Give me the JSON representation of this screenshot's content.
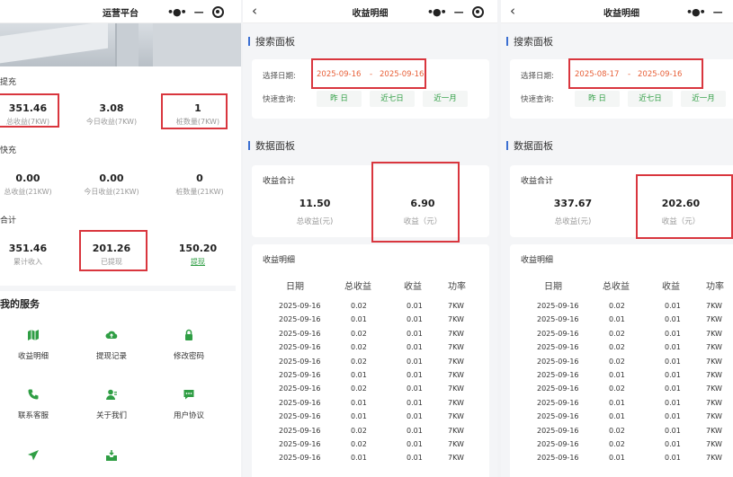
{
  "panel1": {
    "title": "运营平台",
    "section_a": "提充",
    "stats_a": [
      {
        "value": "351.46",
        "label": "总收益(7KW)"
      },
      {
        "value": "3.08",
        "label": "今日收益(7KW)"
      },
      {
        "value": "1",
        "label": "桩数量(7KW)"
      }
    ],
    "section_b": "快充",
    "stats_b": [
      {
        "value": "0.00",
        "label": "总收益(21KW)"
      },
      {
        "value": "0.00",
        "label": "今日收益(21KW)"
      },
      {
        "value": "0",
        "label": "桩数量(21KW)"
      }
    ],
    "section_c": "合计",
    "stats_c": [
      {
        "value": "351.46",
        "label": "累计收入"
      },
      {
        "value": "201.26",
        "label": "已提现"
      },
      {
        "value": "150.20",
        "label": "提现"
      }
    ],
    "services_title": "我的服务",
    "services": [
      {
        "label": "收益明细",
        "icon": "map-icon"
      },
      {
        "label": "提现记录",
        "icon": "cloud-upload-icon"
      },
      {
        "label": "修改密码",
        "icon": "lock-icon"
      },
      {
        "label": "联系客服",
        "icon": "phone-icon"
      },
      {
        "label": "关于我们",
        "icon": "user-info-icon"
      },
      {
        "label": "用户协议",
        "icon": "chat-icon"
      },
      {
        "label": "",
        "icon": "send-icon"
      },
      {
        "label": "",
        "icon": "inbox-download-icon"
      }
    ],
    "accent_color": "#2f9e44"
  },
  "detail": {
    "title": "收益明细",
    "search_panel_label": "搜索面板",
    "date_label": "选择日期:",
    "date_separator": "-",
    "quick_label": "快速查询:",
    "quick_buttons": [
      "昨 日",
      "近七日",
      "近一月"
    ],
    "data_panel_label": "数据面板",
    "sum_title": "收益合计",
    "total_label": "总收益(元)",
    "income_label": "收益（元）",
    "detail_title": "收益明细",
    "table_headers": [
      "日期",
      "总收益",
      "收益",
      "功率"
    ]
  },
  "panel2": {
    "date_start": "2025-09-16",
    "date_end": "2025-09-16",
    "total": "11.50",
    "income": "6.90",
    "rows": [
      [
        "2025-09-16",
        "0.02",
        "0.01",
        "7KW"
      ],
      [
        "2025-09-16",
        "0.01",
        "0.01",
        "7KW"
      ],
      [
        "2025-09-16",
        "0.02",
        "0.01",
        "7KW"
      ],
      [
        "2025-09-16",
        "0.02",
        "0.01",
        "7KW"
      ],
      [
        "2025-09-16",
        "0.02",
        "0.01",
        "7KW"
      ],
      [
        "2025-09-16",
        "0.01",
        "0.01",
        "7KW"
      ],
      [
        "2025-09-16",
        "0.02",
        "0.01",
        "7KW"
      ],
      [
        "2025-09-16",
        "0.01",
        "0.01",
        "7KW"
      ],
      [
        "2025-09-16",
        "0.01",
        "0.01",
        "7KW"
      ],
      [
        "2025-09-16",
        "0.02",
        "0.01",
        "7KW"
      ],
      [
        "2025-09-16",
        "0.02",
        "0.01",
        "7KW"
      ],
      [
        "2025-09-16",
        "0.01",
        "0.01",
        "7KW"
      ]
    ]
  },
  "panel3": {
    "date_start": "2025-08-17",
    "date_end": "2025-09-16",
    "total": "337.67",
    "income": "202.60",
    "rows": [
      [
        "2025-09-16",
        "0.02",
        "0.01",
        "7KW"
      ],
      [
        "2025-09-16",
        "0.01",
        "0.01",
        "7KW"
      ],
      [
        "2025-09-16",
        "0.02",
        "0.01",
        "7KW"
      ],
      [
        "2025-09-16",
        "0.02",
        "0.01",
        "7KW"
      ],
      [
        "2025-09-16",
        "0.02",
        "0.01",
        "7KW"
      ],
      [
        "2025-09-16",
        "0.01",
        "0.01",
        "7KW"
      ],
      [
        "2025-09-16",
        "0.02",
        "0.01",
        "7KW"
      ],
      [
        "2025-09-16",
        "0.01",
        "0.01",
        "7KW"
      ],
      [
        "2025-09-16",
        "0.01",
        "0.01",
        "7KW"
      ],
      [
        "2025-09-16",
        "0.02",
        "0.01",
        "7KW"
      ],
      [
        "2025-09-16",
        "0.02",
        "0.01",
        "7KW"
      ],
      [
        "2025-09-16",
        "0.01",
        "0.01",
        "7KW"
      ]
    ]
  }
}
